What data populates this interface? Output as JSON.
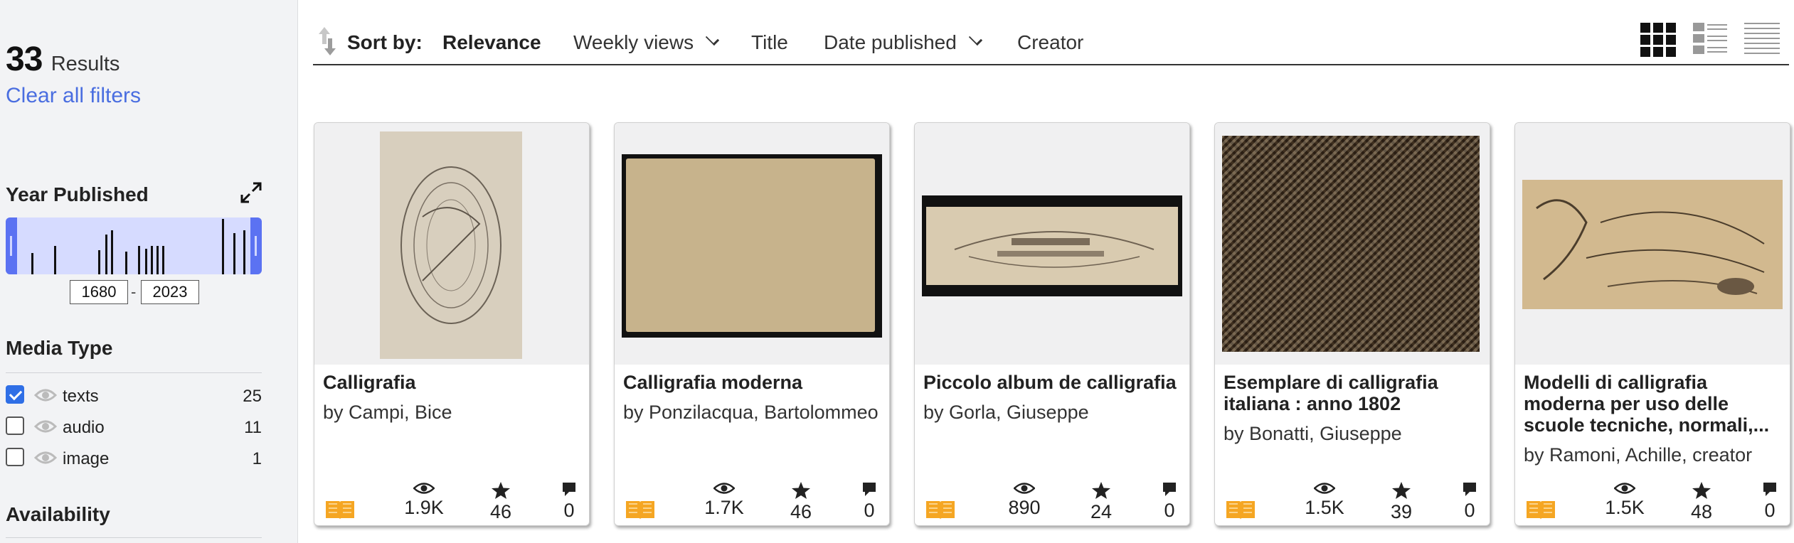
{
  "results": {
    "count": "33",
    "label": "Results",
    "clear_filters": "Clear all filters"
  },
  "year_facet": {
    "title": "Year Published",
    "from": "1680",
    "to": "2023",
    "separator": "-"
  },
  "media_facet": {
    "title": "Media Type",
    "items": [
      {
        "label": "texts",
        "count": "25",
        "checked": true
      },
      {
        "label": "audio",
        "count": "11",
        "checked": false
      },
      {
        "label": "image",
        "count": "1",
        "checked": false
      }
    ]
  },
  "availability": {
    "title": "Availability"
  },
  "sort": {
    "label": "Sort by:",
    "options": [
      "Relevance",
      "Weekly views",
      "Title",
      "Date published",
      "Creator"
    ],
    "active": "Relevance"
  },
  "colors": {
    "accent": "#4a6ee0",
    "histogram": "#d6dbff",
    "handle": "#5b72f2",
    "book": "#f5a623"
  },
  "cards": [
    {
      "title": "Calligrafia",
      "creator": "by Campi, Bice",
      "views": "1.9K",
      "favorites": "46",
      "reviews": "0"
    },
    {
      "title": "Calligrafia moderna",
      "creator": "by Ponzilacqua, Bartolommeo",
      "views": "1.7K",
      "favorites": "46",
      "reviews": "0"
    },
    {
      "title": "Piccolo album de calligrafia",
      "creator": "by Gorla, Giuseppe",
      "views": "890",
      "favorites": "24",
      "reviews": "0"
    },
    {
      "title": "Esemplare di calligrafia italiana : anno 1802",
      "creator": "by Bonatti, Giuseppe",
      "views": "1.5K",
      "favorites": "39",
      "reviews": "0"
    },
    {
      "title": "Modelli di calligrafia moderna per uso delle scuole tecniche, normali,...",
      "creator": "by Ramoni, Achille, creator",
      "views": "1.5K",
      "favorites": "48",
      "reviews": "0"
    }
  ]
}
